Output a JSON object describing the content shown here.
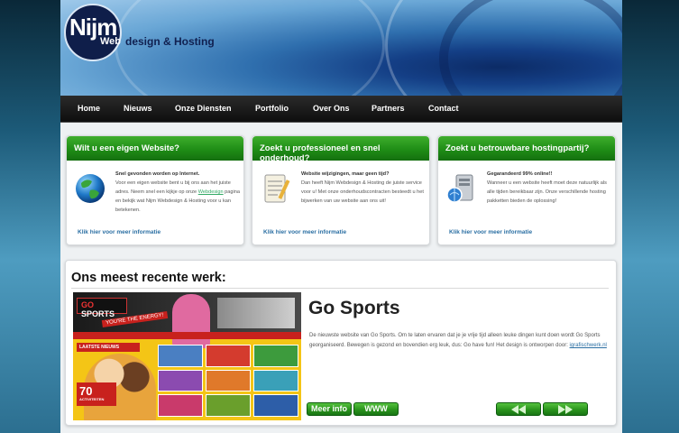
{
  "logo": {
    "main": "Nijm",
    "web": "Web",
    "rest": "design & Hosting"
  },
  "nav": {
    "items": [
      {
        "label": "Home"
      },
      {
        "label": "Nieuws"
      },
      {
        "label": "Onze Diensten"
      },
      {
        "label": "Portfolio"
      },
      {
        "label": "Over Ons"
      },
      {
        "label": "Partners"
      },
      {
        "label": "Contact"
      }
    ]
  },
  "boxes": [
    {
      "title": "Wilt u een eigen Website?",
      "icon": "globe-icon",
      "heading": "Snel gevonden worden op Internet.",
      "text_before": "Voor een eigen website bent u bij ons aan het juiste adres. Neem snel een kijkje op onze ",
      "link_word": "Webdesign",
      "text_after": " pagina en bekijk wat Nijm Webdesign & Hosting voor u kan betekenen.",
      "more": "Klik hier voor meer informatie"
    },
    {
      "title": "Zoekt u professioneel en snel onderhoud?",
      "icon": "notepad-icon",
      "heading": "Website wijzigingen, maar geen tijd?",
      "text": "Dan heeft Nijm Webdesign & Hosting de juiste service voor u! Met onze onderhoudscontracten besteedt u het bijwerken van uw website aan ons uit!",
      "more": "Klik hier voor meer informatie"
    },
    {
      "title": "Zoekt u betrouwbare hostingpartij?",
      "icon": "server-icon",
      "heading": "Gegarandeerd 99% online!!",
      "text": "Wanneer u een website heeft moet deze natuurlijk als alle tijden bereikbaar zijn. Onze verschillende hosting pakketten bieden de oplossing!",
      "more": "Klik hier voor meer informatie"
    }
  ],
  "recent": {
    "title": "Ons meest recente werk:",
    "project_title": "Go Sports",
    "text": "De nieuwste website van Go Sports. Om te laten ervaren dat je je vrije tijd alleen leuke dingen kunt doen wordt Go Sports georganiseerd. Bewegen is gezond en bovendien erg leuk, dus: Go have fun! Het design is ontworpen door: ",
    "designer_link": "igrafischwerk.nl",
    "screenshot": {
      "logo_go": "GO",
      "logo_sports": "SPORTS",
      "tagline": "YOU'RE THE ENERGY!",
      "laatste": "LAATSTE NIEUWS",
      "seventy": "70",
      "activiteiten": "ACTIVITEITEN"
    },
    "buttons": {
      "meer_info": "Meer info",
      "www": "WWW"
    },
    "colors": {
      "green": "#1f8d16",
      "accent_link": "#2b6fa3"
    }
  }
}
